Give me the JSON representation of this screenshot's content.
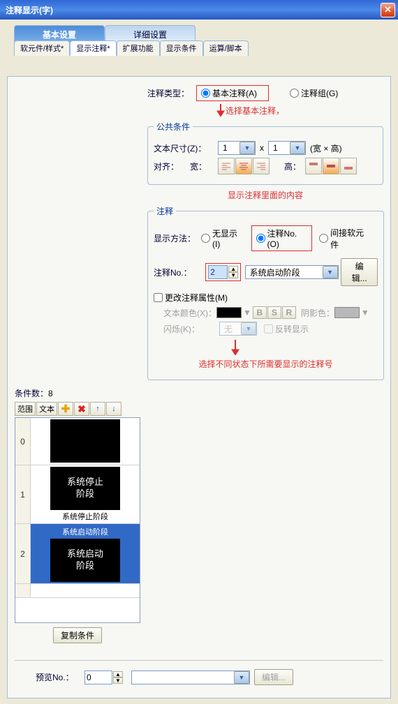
{
  "window": {
    "title": "注释显示(字)"
  },
  "main_tabs": {
    "basic": "基本设置",
    "detail": "详细设置"
  },
  "sub_tabs": {
    "s1": "软元件/样式*",
    "s2": "显示注释*",
    "s3": "扩展功能",
    "s4": "显示条件",
    "s5": "运算/脚本"
  },
  "type": {
    "label": "注释类型：",
    "basic": "基本注释(A)",
    "group": "注释组(G)"
  },
  "annot": {
    "select_basic": "选择基本注释，",
    "disp_content": "显示注释里面的内容",
    "select_no": "选择不同状态下所需要显示的注释号"
  },
  "cond": {
    "count_lbl": "条件数：",
    "count": "8"
  },
  "toolbar": {
    "range": "范围",
    "text": "文本"
  },
  "list": {
    "r0_caption": "",
    "r1_text": "系统停止\n阶段",
    "r1_caption": "系统停止阶段",
    "r2_text": "系统启动\n阶段",
    "r2_caption": "系统启动阶段"
  },
  "copy_btn": "复制条件",
  "pub": {
    "legend": "公共条件",
    "size_lbl": "文本尺寸(Z)：",
    "w": "1",
    "h": "1",
    "x": "x",
    "wh": "(宽 × 高)",
    "align_lbl": "对齐：",
    "align_w": "宽：",
    "align_h": "高："
  },
  "note": {
    "legend": "注释",
    "method_lbl": "显示方法：",
    "none": "无显示(I)",
    "byno": "注释No.(O)",
    "indirect": "间接软元件",
    "no_lbl": "注释No.：",
    "no_val": "2",
    "sel": "系统启动阶段",
    "edit": "编辑...",
    "chg": "更改注释属性(M)",
    "color_lbl": "文本颜色(X)：",
    "shadow_lbl": "阴影色：",
    "blink_lbl": "闪烁(K)：",
    "blink_val": "无",
    "invert": "反转显示"
  },
  "preview": {
    "lbl": "预览No.：",
    "val": "0",
    "edit": "编辑..."
  }
}
